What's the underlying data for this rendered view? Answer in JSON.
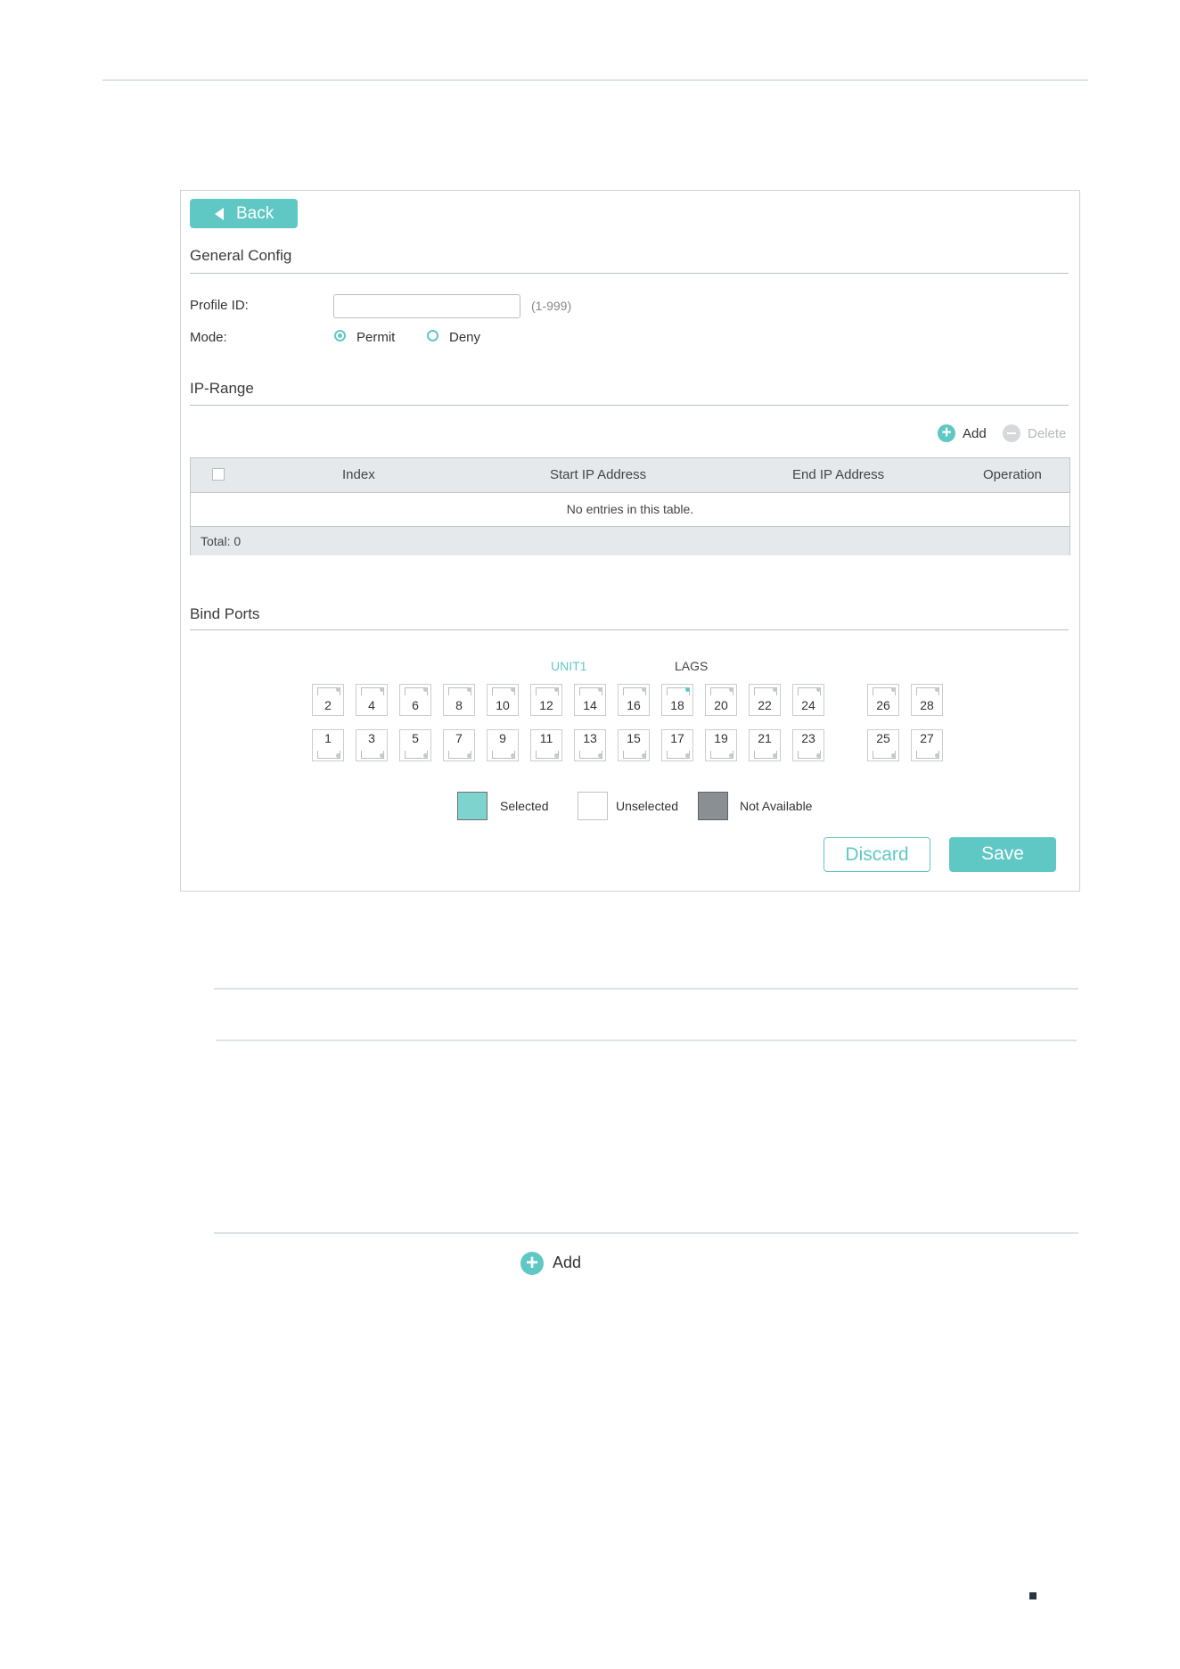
{
  "back_label": "Back",
  "general": {
    "title": "General Config",
    "profile_id_label": "Profile ID:",
    "profile_id_value": "",
    "profile_id_hint": "(1-999)",
    "mode_label": "Mode:",
    "mode_options": [
      "Permit",
      "Deny"
    ],
    "mode_selected": "Permit"
  },
  "ip_range": {
    "title": "IP-Range",
    "add_label": "Add",
    "delete_label": "Delete",
    "columns": [
      "Index",
      "Start IP Address",
      "End IP Address",
      "Operation"
    ],
    "empty_text": "No entries in this table.",
    "total_text": "Total: 0"
  },
  "bind_ports": {
    "title": "Bind Ports",
    "unit_tab": "UNIT1",
    "lags_tab": "LAGS",
    "top_ports": [
      "2",
      "4",
      "6",
      "8",
      "10",
      "12",
      "14",
      "16",
      "18",
      "20",
      "22",
      "24",
      "26",
      "28"
    ],
    "bottom_ports": [
      "1",
      "3",
      "5",
      "7",
      "9",
      "11",
      "13",
      "15",
      "17",
      "19",
      "21",
      "23",
      "25",
      "27"
    ],
    "legend": {
      "selected": "Selected",
      "unselected": "Unselected",
      "not_available": "Not Available"
    }
  },
  "discard_label": "Discard",
  "save_label": "Save",
  "bottom_add_label": "Add",
  "colors": {
    "accent": "#5fc8c4",
    "not_available": "#8a8f94",
    "border": "#c2c8cd"
  }
}
